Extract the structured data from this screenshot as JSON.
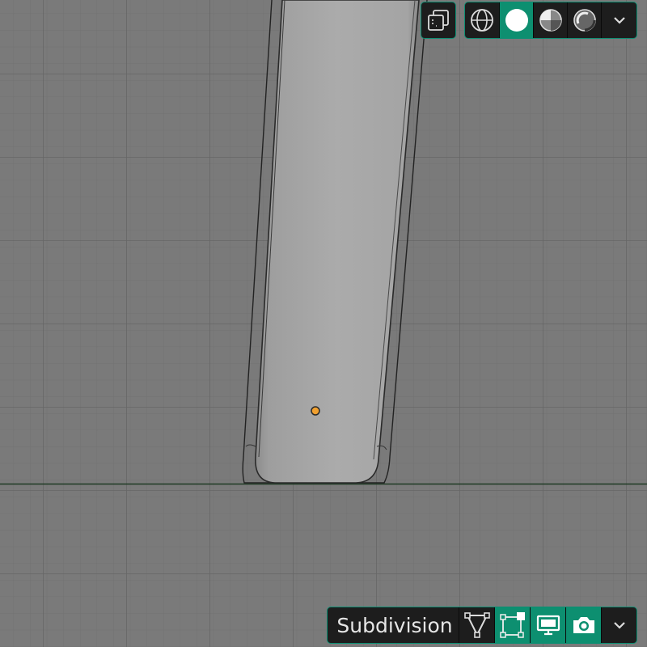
{
  "viewport": {
    "grid_color": "#6e6e6e",
    "background_color": "#7a7a7a",
    "horizon_color": "#1f3a25",
    "object_color": "#a9a9a9",
    "origin_color": "#f0a030"
  },
  "shading_header": {
    "xray_icon": "xray-toggle-icon",
    "modes": [
      {
        "icon": "wireframe-shading-icon",
        "active": false
      },
      {
        "icon": "solid-shading-icon",
        "active": true
      },
      {
        "icon": "material-preview-shading-icon",
        "active": false
      },
      {
        "icon": "rendered-shading-icon",
        "active": false
      }
    ],
    "dropdown_icon": "chevron-down-icon"
  },
  "modifier_panel": {
    "name": "Subdivision",
    "toggles": [
      {
        "icon": "edit-mode-cage-icon",
        "active": false
      },
      {
        "icon": "edit-mode-icon",
        "active": true
      },
      {
        "icon": "viewport-display-icon",
        "active": true
      },
      {
        "icon": "render-camera-icon",
        "active": true
      }
    ],
    "dropdown_icon": "chevron-down-icon",
    "accent_color": "#0d8f70"
  }
}
